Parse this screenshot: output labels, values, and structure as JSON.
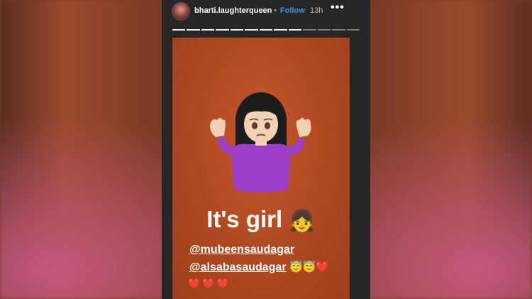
{
  "header": {
    "username": "bharti.laughterqueen",
    "separator": "•",
    "follow_label": "Follow",
    "time": "13h",
    "more": "•••"
  },
  "progress": {
    "total_segments": 13,
    "completed_segments": 9
  },
  "story": {
    "caption_text": "It's girl",
    "caption_emoji": "👧",
    "mentions": [
      {
        "handle": "@mubeensaudagar",
        "suffix": ""
      },
      {
        "handle": "@alsabasaudagar",
        "suffix": "😇😇❤️"
      }
    ],
    "hearts": "❤️❤️❤️"
  },
  "colors": {
    "follow": "#3d96e8",
    "story_bg": "#b24a22",
    "shirt": "#9b3fc9"
  }
}
